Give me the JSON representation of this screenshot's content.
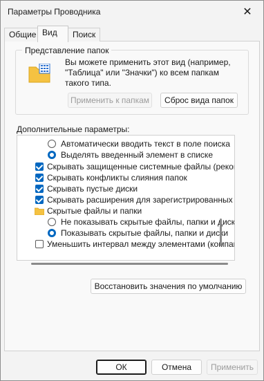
{
  "window": {
    "title": "Параметры Проводника",
    "close_glyph": "✕"
  },
  "tabs": [
    {
      "label": "Общие",
      "selected": false
    },
    {
      "label": "Вид",
      "selected": true
    },
    {
      "label": "Поиск",
      "selected": false
    }
  ],
  "folder_views": {
    "group_title": "Представление папок",
    "icon": "folder-grid-icon",
    "description": "Вы можете применить этот вид (например, \"Таблица\" или \"Значки\") ко всем папкам такого типа.",
    "apply_button": "Применить к папкам",
    "reset_button": "Сброс вида папок"
  },
  "advanced": {
    "label": "Дополнительные параметры:",
    "items": [
      {
        "type": "radio",
        "checked": false,
        "indent": 1,
        "text": "Автоматически вводить текст в поле поиска"
      },
      {
        "type": "radio",
        "checked": true,
        "indent": 1,
        "text": "Выделять введенный элемент в списке"
      },
      {
        "type": "checkbox",
        "checked": true,
        "indent": 0,
        "text": "Скрывать защищенные системные файлы (рекомен"
      },
      {
        "type": "checkbox",
        "checked": true,
        "indent": 0,
        "text": "Скрывать конфликты слияния папок"
      },
      {
        "type": "checkbox",
        "checked": true,
        "indent": 0,
        "text": "Скрывать пустые диски"
      },
      {
        "type": "checkbox",
        "checked": true,
        "indent": 0,
        "text": "Скрывать расширения для зарегистрированных типо"
      },
      {
        "type": "folder",
        "checked": false,
        "indent": 0,
        "text": "Скрытые файлы и папки"
      },
      {
        "type": "radio",
        "checked": false,
        "indent": 1,
        "text": "Не показывать скрытые файлы, папки и диски"
      },
      {
        "type": "radio",
        "checked": true,
        "indent": 1,
        "text": "Показывать скрытые файлы, папки и диски"
      },
      {
        "type": "checkbox",
        "checked": false,
        "indent": 0,
        "text": "Уменьшить интервал между элементами (компактн"
      }
    ]
  },
  "restore_button": "Восстановить значения по умолчанию",
  "footer": {
    "ok": "ОК",
    "cancel": "Отмена",
    "apply": "Применить"
  },
  "colors": {
    "accent": "#0067c0",
    "folder": "#f5c242"
  }
}
